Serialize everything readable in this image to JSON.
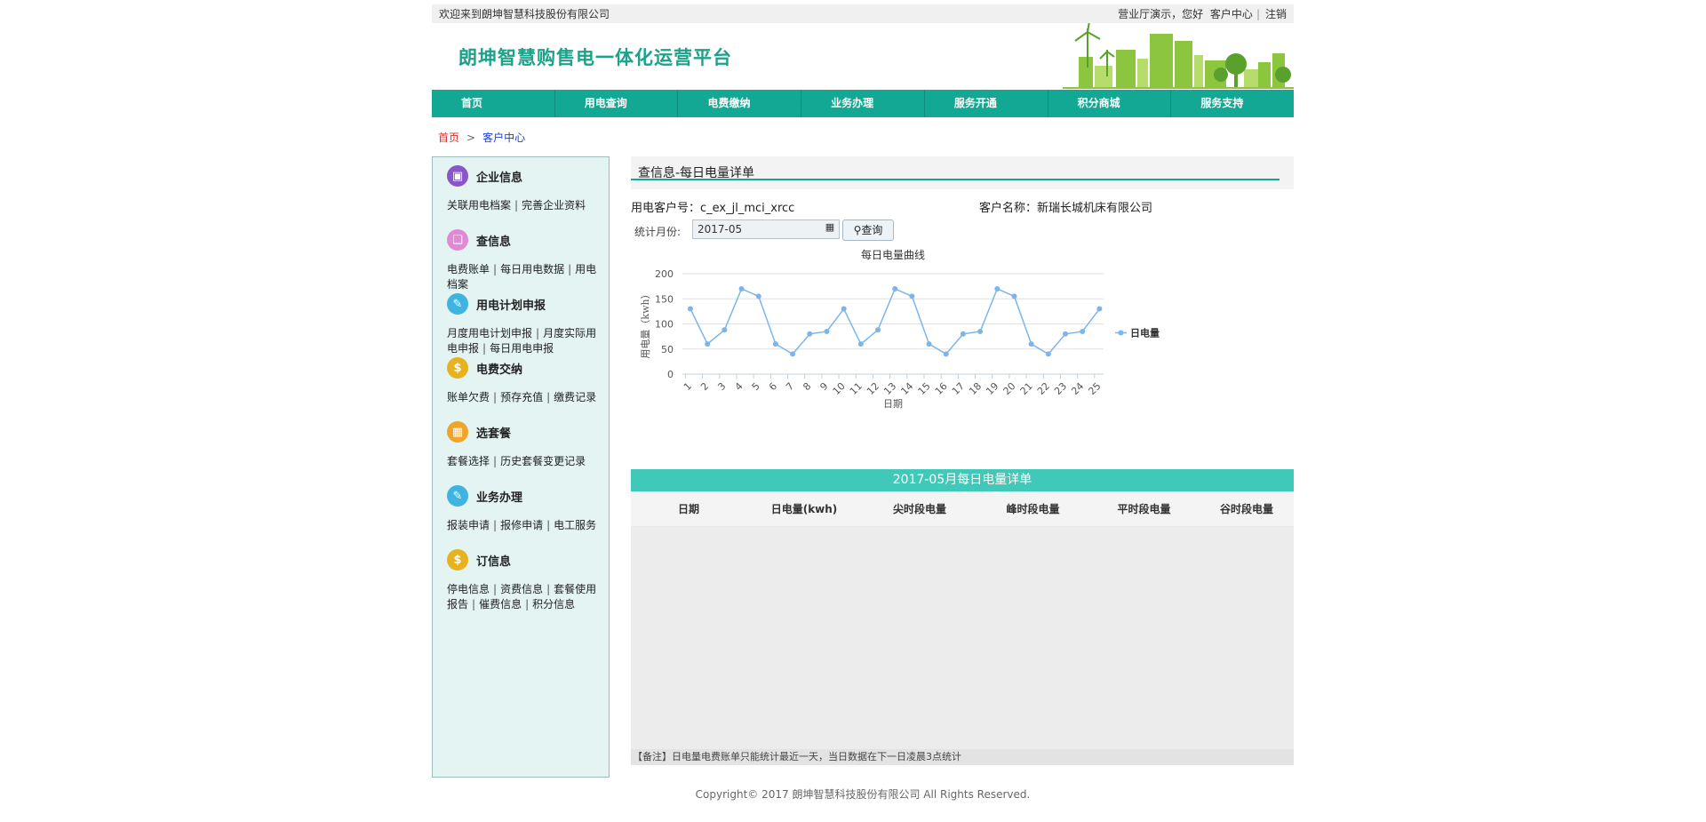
{
  "topbar": {
    "welcome": "欢迎来到朗坤智慧科技股份有限公司",
    "demo": "营业厅演示，您好",
    "customer_center": "客户中心",
    "logout": "注销"
  },
  "header": {
    "title": "朗坤智慧购售电一体化运营平台"
  },
  "nav": [
    "首页",
    "用电查询",
    "电费缴纳",
    "业务办理",
    "服务开通",
    "积分商城",
    "服务支持"
  ],
  "breadcrumb": {
    "home": "首页",
    "sep": ">",
    "current": "客户中心"
  },
  "sidebar": [
    {
      "title": "企业信息",
      "icon": "company-info-icon",
      "color": "#8a55c8",
      "links": [
        "关联用电档案",
        "完善企业资料"
      ]
    },
    {
      "title": "查信息",
      "icon": "query-info-icon",
      "color": "#e08ad6",
      "links": [
        "电费账单",
        "每日用电数据",
        "用电档案"
      ]
    },
    {
      "title": "用电计划申报",
      "icon": "plan-report-icon",
      "color": "#3fb4e0",
      "links": [
        "月度用电计划申报",
        "月度实际用电申报",
        "每日用电申报"
      ]
    },
    {
      "title": "电费交纳",
      "icon": "dollar-icon",
      "color": "#e7b21f",
      "links": [
        "账单欠费",
        "预存充值",
        "缴费记录"
      ]
    },
    {
      "title": "选套餐",
      "icon": "package-icon",
      "color": "#f1a42a",
      "links": [
        "套餐选择",
        "历史套餐变更记录"
      ]
    },
    {
      "title": "业务办理",
      "icon": "business-icon",
      "color": "#3fb4e0",
      "links": [
        "报装申请",
        "报修申请",
        "电工服务"
      ]
    },
    {
      "title": "订信息",
      "icon": "dollar-icon",
      "color": "#e7b21f",
      "links": [
        "停电信息",
        "资费信息",
        "套餐使用报告",
        "催费信息",
        "积分信息"
      ]
    }
  ],
  "main": {
    "title": "查信息-每日电量详单",
    "customer_no_label": "用电客户号：",
    "customer_no": "c_ex_jl_mci_xrcc",
    "customer_name_label": "客户名称：",
    "customer_name": "新瑞长城机床有限公司",
    "month_label": "统计月份:",
    "month_value": "2017-05",
    "query_button": "查询"
  },
  "chart_data": {
    "type": "line",
    "title": "每日电量曲线",
    "xlabel": "日期",
    "ylabel": "用电量（kwh）",
    "ylim": [
      0,
      200
    ],
    "yticks": [
      0,
      50,
      100,
      150,
      200
    ],
    "categories": [
      "1",
      "2",
      "3",
      "4",
      "5",
      "6",
      "7",
      "8",
      "9",
      "10",
      "11",
      "12",
      "13",
      "14",
      "15",
      "16",
      "17",
      "18",
      "19",
      "20",
      "21",
      "22",
      "23",
      "24",
      "25"
    ],
    "series": [
      {
        "name": "日电量",
        "color": "#7cb5ec",
        "values": [
          130,
          60,
          88,
          170,
          155,
          60,
          40,
          80,
          85,
          130,
          60,
          88,
          170,
          155,
          60,
          40,
          80,
          85,
          170,
          155,
          60,
          40,
          80,
          85,
          130
        ]
      }
    ],
    "grid": true,
    "legend": "right"
  },
  "table": {
    "caption": "2017-05月每日电量详单",
    "headers": [
      "日期",
      "日电量(kwh)",
      "尖时段电量",
      "峰时段电量",
      "平时段电量",
      "谷时段电量"
    ]
  },
  "note": "【备注】日电量电费账单只能统计最近一天，当日数据在下一日凌晨3点统计",
  "footer": "Copyright© 2017 朗坤智慧科技股份有限公司 All Rights Reserved."
}
